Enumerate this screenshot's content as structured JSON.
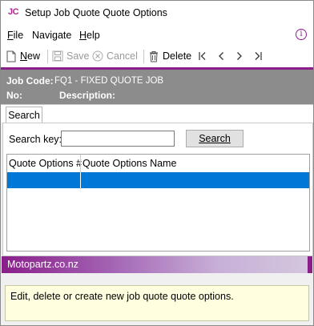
{
  "window": {
    "logo": "JC",
    "title": "Setup Job Quote Quote Options"
  },
  "menu": {
    "file": {
      "underline": "F",
      "rest": "ile"
    },
    "navigate": {
      "underline": "",
      "rest": "Navigate"
    },
    "help": {
      "underline": "H",
      "rest": "elp"
    }
  },
  "toolbar": {
    "new_label_u": "N",
    "new_label_rest": "ew",
    "save_label": "Save",
    "cancel_label": "Cancel",
    "delete_label": "Delete"
  },
  "header": {
    "job_code_label": "Job Code:",
    "job_code_value": "FQ1 - FIXED QUOTE JOB",
    "no_label": "No:",
    "description_label": "Description:"
  },
  "tabs": {
    "search_tab": "Search"
  },
  "search": {
    "key_label": "Search key:",
    "value": "",
    "button_label": "Search"
  },
  "grid": {
    "columns": [
      "Quote Options #",
      "Quote Options Name"
    ],
    "rows": [
      [
        "",
        ""
      ]
    ]
  },
  "brand": {
    "text": "Motopartz.co.nz"
  },
  "help": {
    "text": "Edit, delete or create new job quote quote options."
  },
  "colors": {
    "accent": "#8a1f8a",
    "header_bg": "#8c8c8c",
    "selection": "#0078d7",
    "help_bg": "#ffffe0"
  }
}
